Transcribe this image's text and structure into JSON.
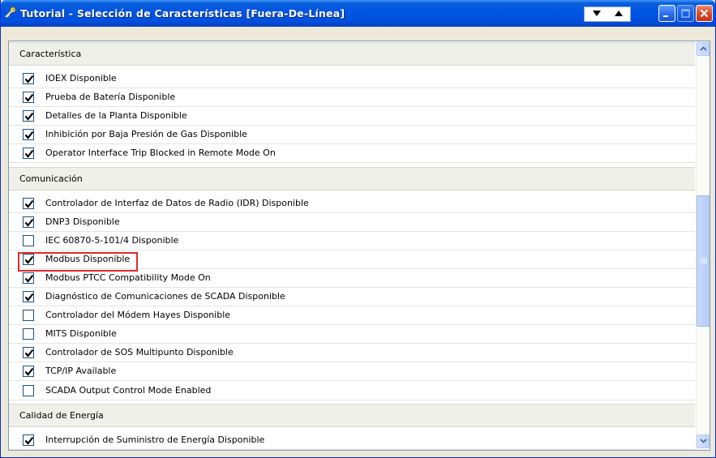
{
  "window": {
    "title": "Tutorial - Selección de Características [Fuera-De-Línea]"
  },
  "sections": [
    {
      "header": "Característica",
      "items": [
        {
          "label": "IOEX Disponible",
          "checked": true
        },
        {
          "label": "Prueba de Batería Disponible",
          "checked": true
        },
        {
          "label": "Detalles de la Planta Disponible",
          "checked": true
        },
        {
          "label": "Inhibición por Baja Presión de Gas Disponible",
          "checked": true
        },
        {
          "label": "Operator Interface Trip Blocked in Remote Mode On",
          "checked": true
        }
      ]
    },
    {
      "header": "Comunicación",
      "items": [
        {
          "label": "Controlador de Interfaz de Datos de Radio (IDR) Disponible",
          "checked": true
        },
        {
          "label": "DNP3 Disponible",
          "checked": true
        },
        {
          "label": "IEC 60870-5-101/4 Disponible",
          "checked": false
        },
        {
          "label": "Modbus Disponible",
          "checked": true,
          "highlighted": true
        },
        {
          "label": "Modbus PTCC Compatibility Mode On",
          "checked": true
        },
        {
          "label": "Diagnóstico de Comunicaciones de SCADA Disponible",
          "checked": true
        },
        {
          "label": "Controlador del Módem Hayes Disponible",
          "checked": false
        },
        {
          "label": "MITS Disponible",
          "checked": false
        },
        {
          "label": "Controlador de SOS Multipunto Disponible",
          "checked": true
        },
        {
          "label": "TCP/IP Available",
          "checked": true
        },
        {
          "label": "SCADA Output Control Mode Enabled",
          "checked": false
        }
      ]
    },
    {
      "header": "Calidad de Energía",
      "items": [
        {
          "label": "Interrupción de Suministro de Energía Disponible",
          "checked": true
        }
      ]
    }
  ],
  "colors": {
    "titlebar": "#0054e3",
    "highlight": "#e0292d",
    "check": "#1c5180"
  }
}
